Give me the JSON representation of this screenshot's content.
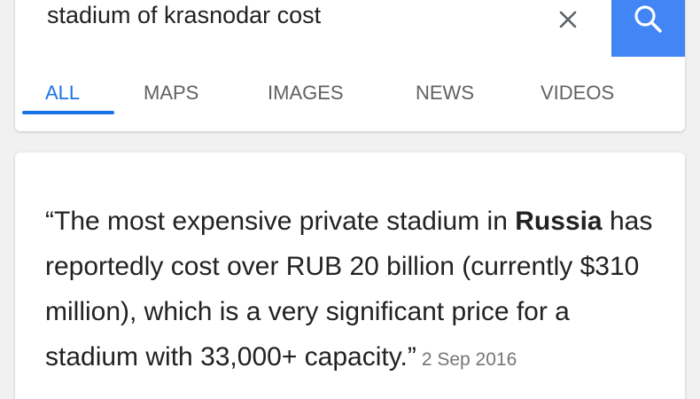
{
  "search": {
    "query": "stadium of krasnodar cost"
  },
  "tabs": [
    {
      "label": "ALL",
      "active": true
    },
    {
      "label": "MAPS"
    },
    {
      "label": "IMAGES"
    },
    {
      "label": "NEWS"
    },
    {
      "label": "VIDEOS"
    }
  ],
  "snippet": {
    "text_before": "“The most expensive private stadium in ",
    "bold": "Russia",
    "text_after": " has reportedly cost over RUB 20 billion (currently $310 million), which is a very significant price for a stadium with 33,000+ capacity.”",
    "date": "2 Sep 2016"
  },
  "icons": {
    "clear": "close-icon",
    "search": "search-icon"
  },
  "colors": {
    "accent": "#1a73e8",
    "search_button": "#4285f4",
    "background": "#f1f1f1"
  }
}
